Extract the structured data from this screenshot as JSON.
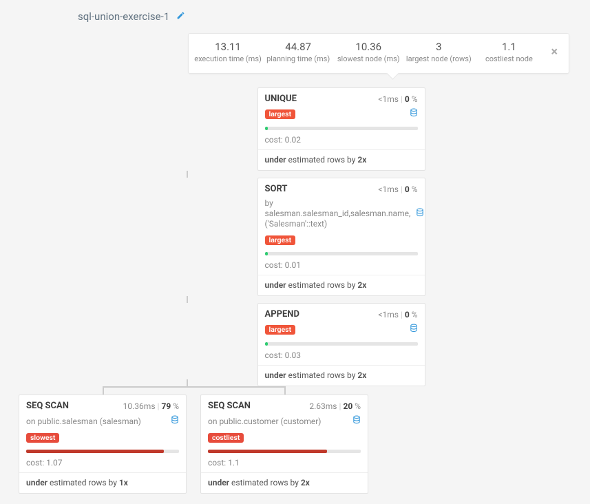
{
  "title": "sql-union-exercise-1",
  "stats": [
    {
      "val": "13.11",
      "lbl": "execution time (ms)"
    },
    {
      "val": "44.87",
      "lbl": "planning time (ms)"
    },
    {
      "val": "10.36",
      "lbl": "slowest node (ms)"
    },
    {
      "val": "3",
      "lbl": "largest node (rows)"
    },
    {
      "val": "1.1",
      "lbl": "costliest node"
    }
  ],
  "nodes": {
    "unique": {
      "name": "UNIQUE",
      "time": "<1ms",
      "pct": "0",
      "tag": "largest",
      "bar_pct": 2,
      "cost": "cost: 0.02",
      "est_factor": "2x"
    },
    "sort": {
      "name": "SORT",
      "time": "<1ms",
      "pct": "0",
      "detail": "by salesman.salesman_id,salesman.name,('Salesman'::text)",
      "tag": "largest",
      "bar_pct": 2,
      "cost": "cost: 0.01",
      "est_factor": "2x"
    },
    "append": {
      "name": "APPEND",
      "time": "<1ms",
      "pct": "0",
      "tag": "largest",
      "bar_pct": 2,
      "cost": "cost: 0.03",
      "est_factor": "2x"
    },
    "seq1": {
      "name": "SEQ SCAN",
      "time": "10.36ms",
      "pct": "79",
      "detail": "on public.salesman (salesman)",
      "tag": "slowest",
      "bar_pct": 90,
      "cost": "cost: 1.07",
      "est_factor": "1x"
    },
    "seq2": {
      "name": "SEQ SCAN",
      "time": "2.63ms",
      "pct": "20",
      "detail": "on public.customer (customer)",
      "tag": "costliest",
      "bar_pct": 78,
      "cost": "cost: 1.1",
      "est_factor": "2x"
    }
  },
  "est_prefix": "under",
  "est_mid": " estimated rows by "
}
